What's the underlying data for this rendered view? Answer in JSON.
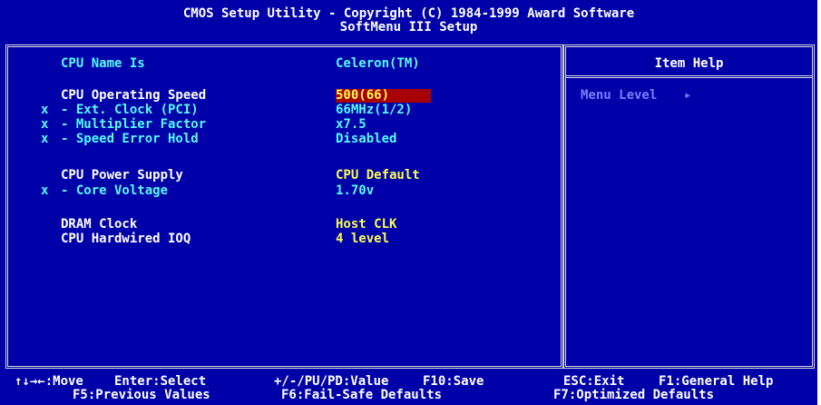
{
  "header": {
    "line1": "CMOS Setup Utility - Copyright (C) 1984-1999 Award Software",
    "line2": "SoftMenu III Setup"
  },
  "items": [
    {
      "prefix": "",
      "label": "CPU Name Is",
      "value": "Celeron(TM)",
      "state": "info"
    },
    {
      "prefix": "",
      "label": "CPU Operating Speed",
      "value": "500(66)",
      "state": "selected"
    },
    {
      "prefix": "x",
      "label": "- Ext. Clock (PCI)",
      "value": "66MHz(1/2)",
      "state": "disabled"
    },
    {
      "prefix": "x",
      "label": "- Multiplier Factor",
      "value": "x7.5",
      "state": "disabled"
    },
    {
      "prefix": "x",
      "label": "- Speed Error Hold",
      "value": "Disabled",
      "state": "disabled"
    },
    {
      "prefix": "",
      "label": "CPU Power Supply",
      "value": "CPU Default",
      "state": "normal"
    },
    {
      "prefix": "x",
      "label": "- Core Voltage",
      "value": "1.70v",
      "state": "disabled"
    },
    {
      "prefix": "",
      "label": "DRAM Clock",
      "value": "Host CLK",
      "state": "normal"
    },
    {
      "prefix": "",
      "label": "CPU Hardwired IOQ",
      "value": "4 level",
      "state": "normal"
    }
  ],
  "help": {
    "title": "Item Help",
    "menu_level": "Menu Level",
    "arrow": "▸"
  },
  "footer": {
    "row1": [
      {
        "key": "↑↓→←:Move"
      },
      {
        "key": "Enter:Select"
      },
      {
        "key": "+/-/PU/PD:Value"
      },
      {
        "key": "F10:Save"
      },
      {
        "key": "ESC:Exit"
      },
      {
        "key": "F1:General Help"
      }
    ],
    "row2": [
      {
        "key": "F5:Previous Values"
      },
      {
        "key": "F6:Fail-Safe Defaults"
      },
      {
        "key": "F7:Optimized Defaults"
      }
    ]
  },
  "colors": {
    "background": "#0000a8",
    "label": "#ffffff",
    "value": "#fcfc54",
    "disabled": "#54fcfc",
    "highlight": "#a80000",
    "border": "#d8d8d8"
  }
}
